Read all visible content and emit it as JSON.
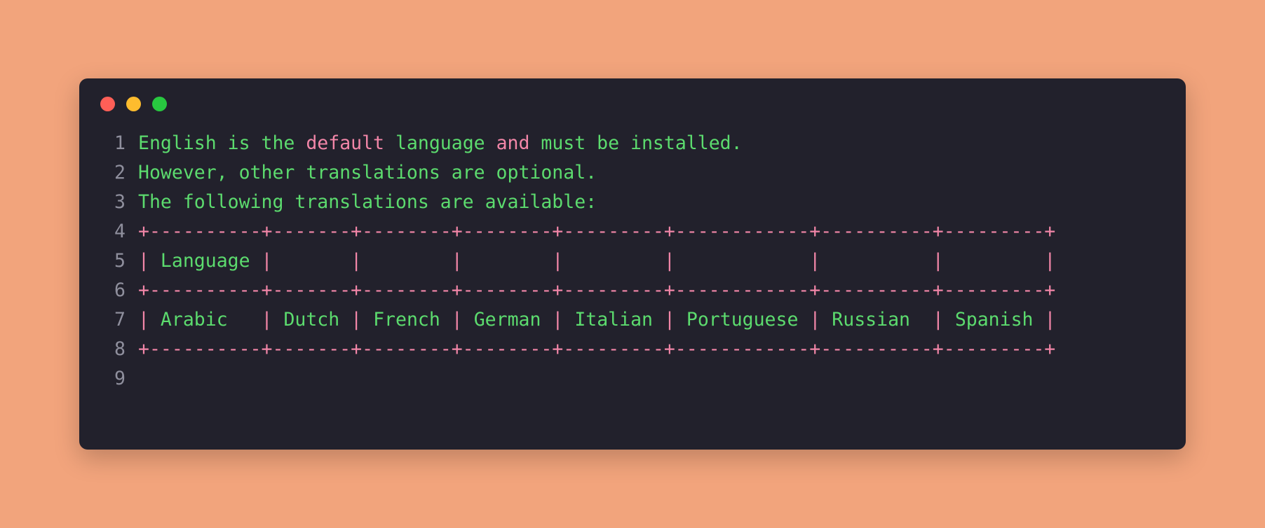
{
  "window": {
    "background_color": "#f2a47c",
    "surface_color": "#22212c",
    "traffic_lights": [
      {
        "name": "close",
        "color": "#ff5f57"
      },
      {
        "name": "minimize",
        "color": "#febc2e"
      },
      {
        "name": "maximize",
        "color": "#28c840"
      }
    ]
  },
  "theme": {
    "text_color": "#5cdb6e",
    "keyword_color": "#f286a8",
    "linenumber_color": "#8f8f9d"
  },
  "editor": {
    "lines": [
      {
        "number": "1",
        "tokens": [
          {
            "text": "English is the ",
            "color": "green"
          },
          {
            "text": "default",
            "color": "pink"
          },
          {
            "text": " language ",
            "color": "green"
          },
          {
            "text": "and",
            "color": "pink"
          },
          {
            "text": " must be installed.",
            "color": "green"
          }
        ]
      },
      {
        "number": "2",
        "tokens": [
          {
            "text": "However, other translations are optional.",
            "color": "green"
          }
        ]
      },
      {
        "number": "3",
        "tokens": [
          {
            "text": "The following translations are available:",
            "color": "green"
          }
        ]
      },
      {
        "number": "4",
        "tokens": [
          {
            "text": "+----------+-------+--------+--------+---------+------------+----------+---------+",
            "color": "pink"
          }
        ]
      },
      {
        "number": "5",
        "tokens": [
          {
            "text": "| ",
            "color": "pink"
          },
          {
            "text": "Language",
            "color": "green"
          },
          {
            "text": " |       |        |        |         |            |          |         |",
            "color": "pink"
          }
        ]
      },
      {
        "number": "6",
        "tokens": [
          {
            "text": "+----------+-------+--------+--------+---------+------------+----------+---------+",
            "color": "pink"
          }
        ]
      },
      {
        "number": "7",
        "tokens": [
          {
            "text": "| ",
            "color": "pink"
          },
          {
            "text": "Arabic",
            "color": "green"
          },
          {
            "text": "   | ",
            "color": "pink"
          },
          {
            "text": "Dutch",
            "color": "green"
          },
          {
            "text": " | ",
            "color": "pink"
          },
          {
            "text": "French",
            "color": "green"
          },
          {
            "text": " | ",
            "color": "pink"
          },
          {
            "text": "German",
            "color": "green"
          },
          {
            "text": " | ",
            "color": "pink"
          },
          {
            "text": "Italian",
            "color": "green"
          },
          {
            "text": " | ",
            "color": "pink"
          },
          {
            "text": "Portuguese",
            "color": "green"
          },
          {
            "text": " | ",
            "color": "pink"
          },
          {
            "text": "Russian",
            "color": "green"
          },
          {
            "text": "  | ",
            "color": "pink"
          },
          {
            "text": "Spanish",
            "color": "green"
          },
          {
            "text": " |",
            "color": "pink"
          }
        ]
      },
      {
        "number": "8",
        "tokens": [
          {
            "text": "+----------+-------+--------+--------+---------+------------+----------+---------+",
            "color": "pink"
          }
        ]
      },
      {
        "number": "9",
        "tokens": []
      }
    ],
    "table": {
      "header": [
        "Language",
        "",
        "",
        "",
        "",
        "",
        "",
        ""
      ],
      "rows": [
        [
          "Arabic",
          "Dutch",
          "French",
          "German",
          "Italian",
          "Portuguese",
          "Russian",
          "Spanish"
        ]
      ]
    },
    "prose": [
      "English is the default language and must be installed.",
      "However, other translations are optional.",
      "The following translations are available:"
    ]
  }
}
